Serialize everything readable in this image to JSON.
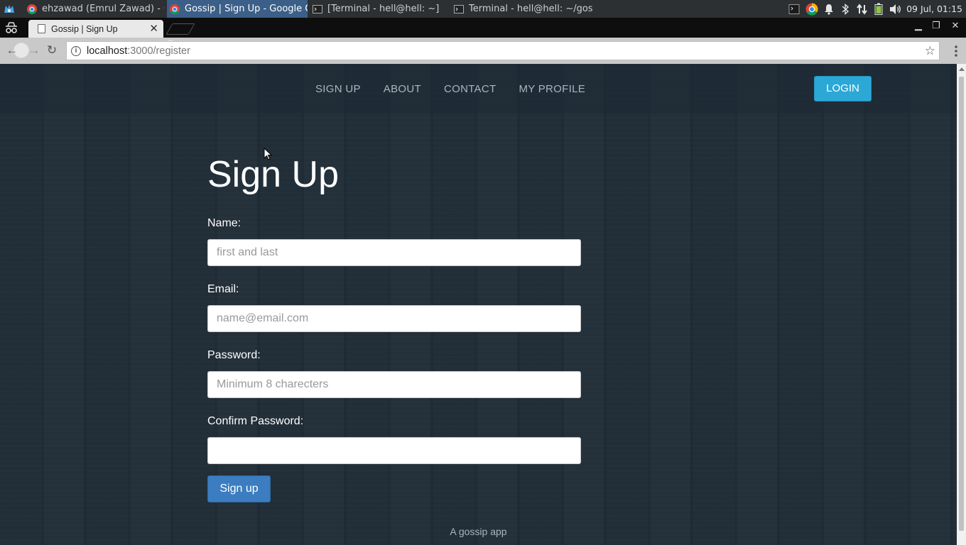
{
  "os": {
    "tasks": [
      {
        "label": "ehzawad (Emrul Zawad) - Go...",
        "icon": "chrome-icon",
        "active": false
      },
      {
        "label": "Gossip | Sign Up - Google C...",
        "icon": "chrome-icon",
        "active": true
      },
      {
        "label": "[Terminal - hell@hell: ~]",
        "icon": "terminal-icon",
        "active": false
      },
      {
        "label": "Terminal - hell@hell: ~/gossip",
        "icon": "terminal-icon",
        "active": false
      }
    ],
    "clock": "09 Jul, 01:15"
  },
  "browser": {
    "tab_title": "Gossip | Sign Up",
    "url_host": "localhost",
    "url_path": ":3000/register"
  },
  "nav": {
    "links": [
      "SIGN UP",
      "ABOUT",
      "CONTACT",
      "MY PROFILE"
    ],
    "login": "LOGIN"
  },
  "form": {
    "title": "Sign Up",
    "name_label": "Name:",
    "name_placeholder": "first and last",
    "email_label": "Email:",
    "email_placeholder": "name@email.com",
    "password_label": "Password:",
    "password_placeholder": "Minimum 8 charecters",
    "confirm_label": "Confirm Password:",
    "confirm_placeholder": "",
    "submit": "Sign up"
  },
  "footer": "A gossip app",
  "colors": {
    "login_button": "#2ba8d6",
    "submit_button": "#3b7dc0",
    "taskbar_active": "#3b5f88"
  }
}
